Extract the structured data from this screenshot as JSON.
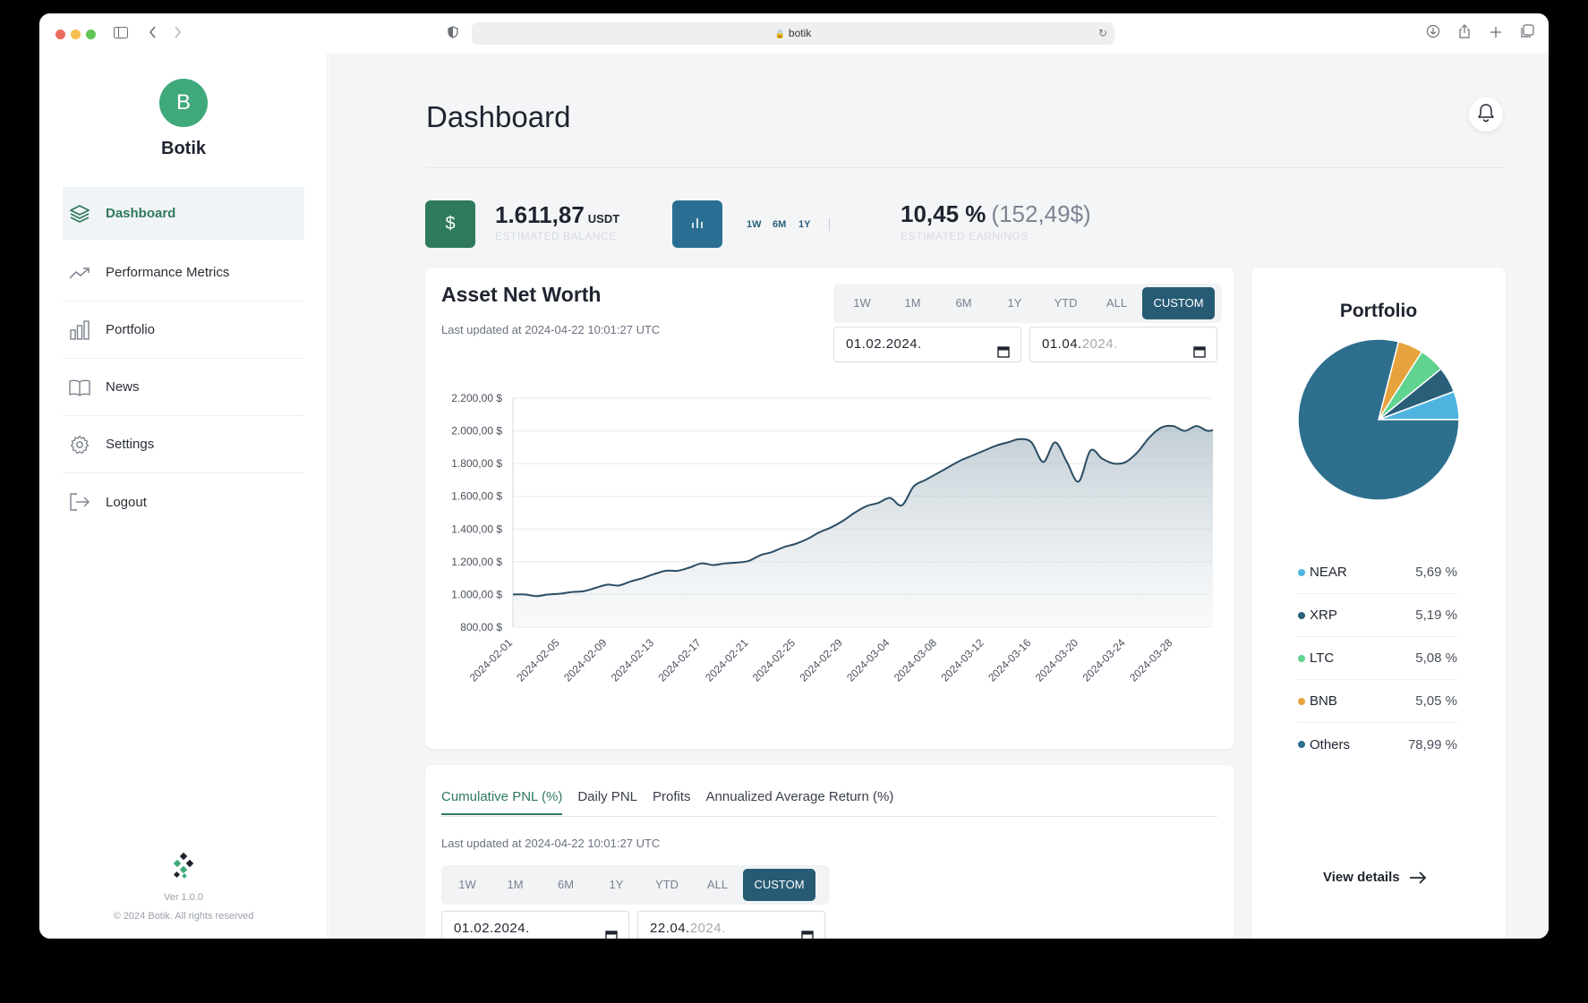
{
  "browser": {
    "url": "botik"
  },
  "sidebar": {
    "avatar_letter": "B",
    "brand": "Botik",
    "items": [
      {
        "label": "Dashboard",
        "icon": "layers-icon",
        "active": true
      },
      {
        "label": "Performance Metrics",
        "icon": "trending-up-icon"
      },
      {
        "label": "Portfolio",
        "icon": "bar-chart-icon"
      },
      {
        "label": "News",
        "icon": "book-icon"
      },
      {
        "label": "Settings",
        "icon": "gear-icon"
      },
      {
        "label": "Logout",
        "icon": "logout-icon"
      }
    ],
    "version": "Ver 1.0.0",
    "copyright": "© 2024 Botik. All rights reserved"
  },
  "header": {
    "title": "Dashboard"
  },
  "stats": {
    "balance_value": "1.611,87",
    "balance_unit": "USDT",
    "balance_label": "ESTIMATED BALANCE",
    "earnings_ranges": [
      "1W",
      "6M",
      "1Y"
    ],
    "earnings_value": "10,45 %",
    "earnings_sub": "(152,49$)",
    "earnings_label": "ESTIMATED EARNINGS",
    "balance_icon_color": "#2f7a5c",
    "earnings_icon_color": "#2a6f93"
  },
  "asset_card": {
    "title": "Asset Net Worth",
    "updated": "Last updated at 2024-04-22 10:01:27 UTC",
    "ranges": [
      "1W",
      "1M",
      "6M",
      "1Y",
      "YTD",
      "ALL",
      "CUSTOM"
    ],
    "active_range": "CUSTOM",
    "date_from": {
      "main": "01.02.2024."
    },
    "date_to": {
      "main": "01.04.",
      "grey": "2024."
    }
  },
  "chart_data": {
    "type": "area",
    "title": "Asset Net Worth",
    "ylim": [
      800,
      2200
    ],
    "y_ticks": [
      "2.200,00 $",
      "2.000,00 $",
      "1.800,00 $",
      "1.600,00 $",
      "1.400,00 $",
      "1.200,00 $",
      "1.000,00 $",
      "800,00 $"
    ],
    "y_tick_values": [
      2200,
      2000,
      1800,
      1600,
      1400,
      1200,
      1000,
      800
    ],
    "x_ticks": [
      "2024-02-01",
      "2024-02-05",
      "2024-02-09",
      "2024-02-13",
      "2024-02-17",
      "2024-02-21",
      "2024-02-25",
      "2024-02-29",
      "2024-03-04",
      "2024-03-08",
      "2024-03-12",
      "2024-03-16",
      "2024-03-20",
      "2024-03-24",
      "2024-03-28"
    ],
    "x": [
      "2024-02-01",
      "2024-02-02",
      "2024-02-03",
      "2024-02-04",
      "2024-02-05",
      "2024-02-06",
      "2024-02-07",
      "2024-02-08",
      "2024-02-09",
      "2024-02-10",
      "2024-02-11",
      "2024-02-12",
      "2024-02-13",
      "2024-02-14",
      "2024-02-15",
      "2024-02-16",
      "2024-02-17",
      "2024-02-18",
      "2024-02-19",
      "2024-02-20",
      "2024-02-21",
      "2024-02-22",
      "2024-02-23",
      "2024-02-24",
      "2024-02-25",
      "2024-02-26",
      "2024-02-27",
      "2024-02-28",
      "2024-02-29",
      "2024-03-01",
      "2024-03-02",
      "2024-03-03",
      "2024-03-04",
      "2024-03-05",
      "2024-03-06",
      "2024-03-07",
      "2024-03-08",
      "2024-03-09",
      "2024-03-10",
      "2024-03-11",
      "2024-03-12",
      "2024-03-13",
      "2024-03-14",
      "2024-03-15",
      "2024-03-16",
      "2024-03-17",
      "2024-03-18",
      "2024-03-19",
      "2024-03-20",
      "2024-03-21",
      "2024-03-22",
      "2024-03-23",
      "2024-03-24",
      "2024-03-25",
      "2024-03-26",
      "2024-03-27",
      "2024-03-28",
      "2024-03-29",
      "2024-03-30",
      "2024-03-31",
      "2024-04-01"
    ],
    "values": [
      1000,
      1000,
      990,
      1000,
      1005,
      1015,
      1020,
      1040,
      1060,
      1055,
      1080,
      1100,
      1125,
      1145,
      1145,
      1165,
      1190,
      1180,
      1190,
      1195,
      1205,
      1240,
      1260,
      1290,
      1310,
      1340,
      1380,
      1410,
      1450,
      1500,
      1540,
      1560,
      1590,
      1545,
      1660,
      1700,
      1740,
      1780,
      1820,
      1850,
      1880,
      1910,
      1930,
      1950,
      1930,
      1810,
      1930,
      1810,
      1690,
      1880,
      1830,
      1800,
      1810,
      1870,
      1960,
      2020,
      2030,
      2000,
      2030,
      2000,
      2020
    ],
    "color": "#2b4d63",
    "grid": true
  },
  "pnl_card": {
    "tabs": [
      "Cumulative PNL (%)",
      "Daily PNL",
      "Profits",
      "Annualized Average Return (%)"
    ],
    "active_tab": "Cumulative PNL (%)",
    "updated": "Last updated at 2024-04-22 10:01:27 UTC",
    "ranges": [
      "1W",
      "1M",
      "6M",
      "1Y",
      "YTD",
      "ALL",
      "CUSTOM"
    ],
    "active_range": "CUSTOM",
    "date_from": {
      "main": "01.02.2024."
    },
    "date_to": {
      "main": "22.04.",
      "grey": "2024."
    }
  },
  "portfolio": {
    "title": "Portfolio",
    "items": [
      {
        "name": "NEAR",
        "value": "5,69 %",
        "pct": 5.69,
        "color": "#4fb3e0"
      },
      {
        "name": "XRP",
        "value": "5,19 %",
        "pct": 5.19,
        "color": "#2a5f7a"
      },
      {
        "name": "LTC",
        "value": "5,08 %",
        "pct": 5.08,
        "color": "#5fd38f"
      },
      {
        "name": "BNB",
        "value": "5,05 %",
        "pct": 5.05,
        "color": "#e6a23c"
      },
      {
        "name": "Others",
        "value": "78,99 %",
        "pct": 78.99,
        "color": "#2e6f8e"
      }
    ],
    "view_details": "View details"
  }
}
